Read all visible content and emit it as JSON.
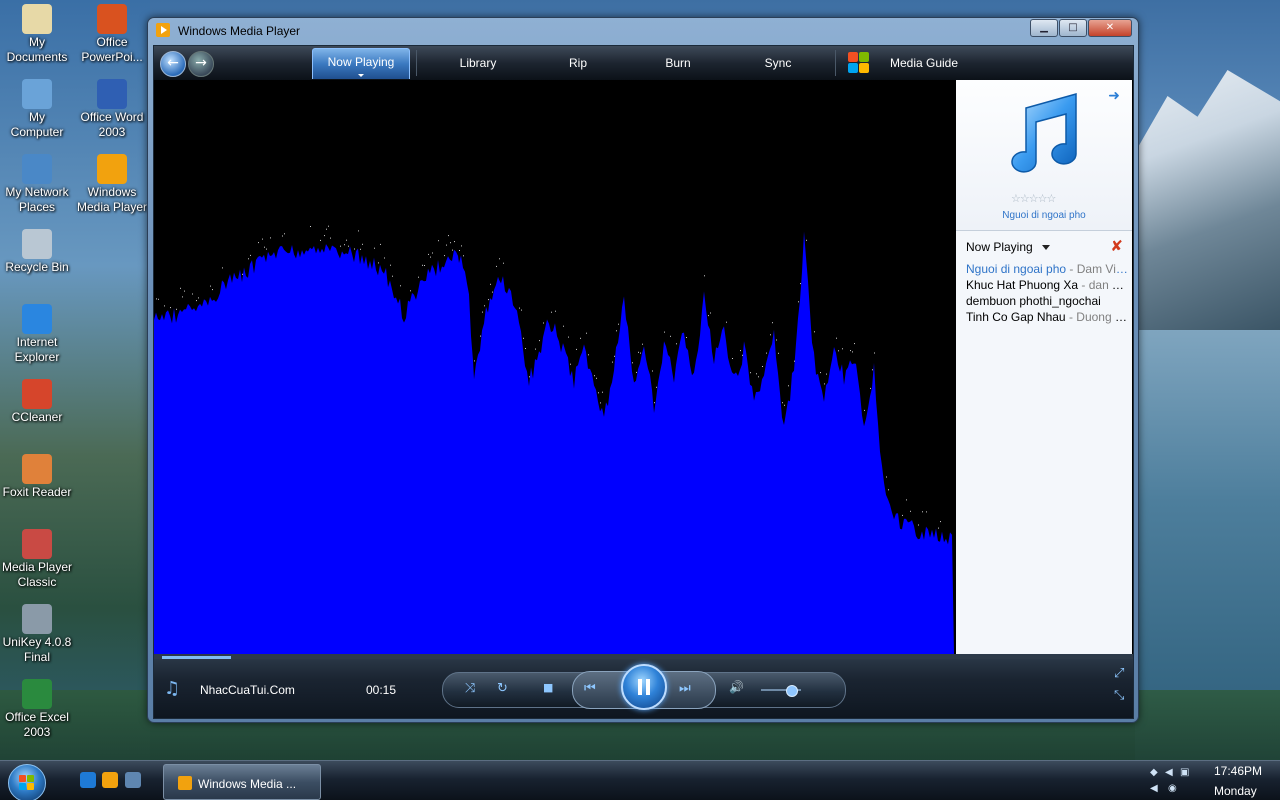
{
  "desktop": {
    "icons": [
      {
        "label_1": "My",
        "label_2": "Documents",
        "icon": "my-documents-icon"
      },
      {
        "label_1": "Office",
        "label_2": "PowerPoi...",
        "icon": "powerpoint-icon"
      },
      {
        "label_1": "My",
        "label_2": "Computer",
        "icon": "computer-icon"
      },
      {
        "label_1": "Office Word",
        "label_2": "2003",
        "icon": "word-icon"
      },
      {
        "label_1": "My Network",
        "label_2": "Places",
        "icon": "network-icon"
      },
      {
        "label_1": "Windows",
        "label_2": "Media Player",
        "icon": "media-player-icon"
      },
      {
        "label_1": "Recycle Bin",
        "label_2": "",
        "icon": "recycle-bin-icon"
      },
      {
        "label_1": "Internet",
        "label_2": "Explorer",
        "icon": "ie-icon"
      },
      {
        "label_1": "CCleaner",
        "label_2": "",
        "icon": "ccleaner-icon"
      },
      {
        "label_1": "Foxit Reader",
        "label_2": "",
        "icon": "foxit-icon"
      },
      {
        "label_1": "Media Player",
        "label_2": "Classic",
        "icon": "mpc-icon"
      },
      {
        "label_1": "UniKey 4.0.8",
        "label_2": "Final",
        "icon": "unikey-icon"
      },
      {
        "label_1": "Office Excel",
        "label_2": "2003",
        "icon": "excel-icon"
      }
    ]
  },
  "window": {
    "title": "Windows Media Player",
    "min_label": "▁",
    "max_label": "□",
    "close_label": "✕"
  },
  "nav": {
    "back": "←",
    "forward": "→",
    "tabs": [
      "Now Playing",
      "Library",
      "Rip",
      "Burn",
      "Sync",
      "Media Guide"
    ]
  },
  "sidebar": {
    "art_arrow": "➜",
    "rating": "☆☆☆☆☆",
    "album_title": "Nguoi di ngoai pho",
    "list_header": "Now Playing",
    "clear_icon": "✘",
    "playlist": [
      {
        "title": "Nguoi di ngoai pho",
        "artist": " - Dam Vinh Hung"
      },
      {
        "title": "Khuc Hat Phuong Xa",
        "artist": " - dan Truong"
      },
      {
        "title": "dembuon phothi_ngochai",
        "artist": ""
      },
      {
        "title": "Tinh Co Gap Nhau",
        "artist": " - Duong Ngoc Thai"
      }
    ]
  },
  "controls": {
    "source": "NhacCuaTui.Com",
    "time": "00:15",
    "note_icon": "♫",
    "shuffle_icon": "⤨",
    "repeat_icon": "↻",
    "stop_icon": "■",
    "prev_icon": "⏮",
    "next_icon": "⏭",
    "volume_icon": "🔊",
    "fullscreen_icon": "⤢",
    "compact_icon": "⤡",
    "seek_progress_percent": 7,
    "volume_percent": 75
  },
  "taskbar": {
    "task_label": "Windows Media ...",
    "clock": "17:46PM",
    "day": "Monday"
  },
  "colors": {
    "visualization": "#0000ff",
    "accent": "#2f74c8"
  }
}
